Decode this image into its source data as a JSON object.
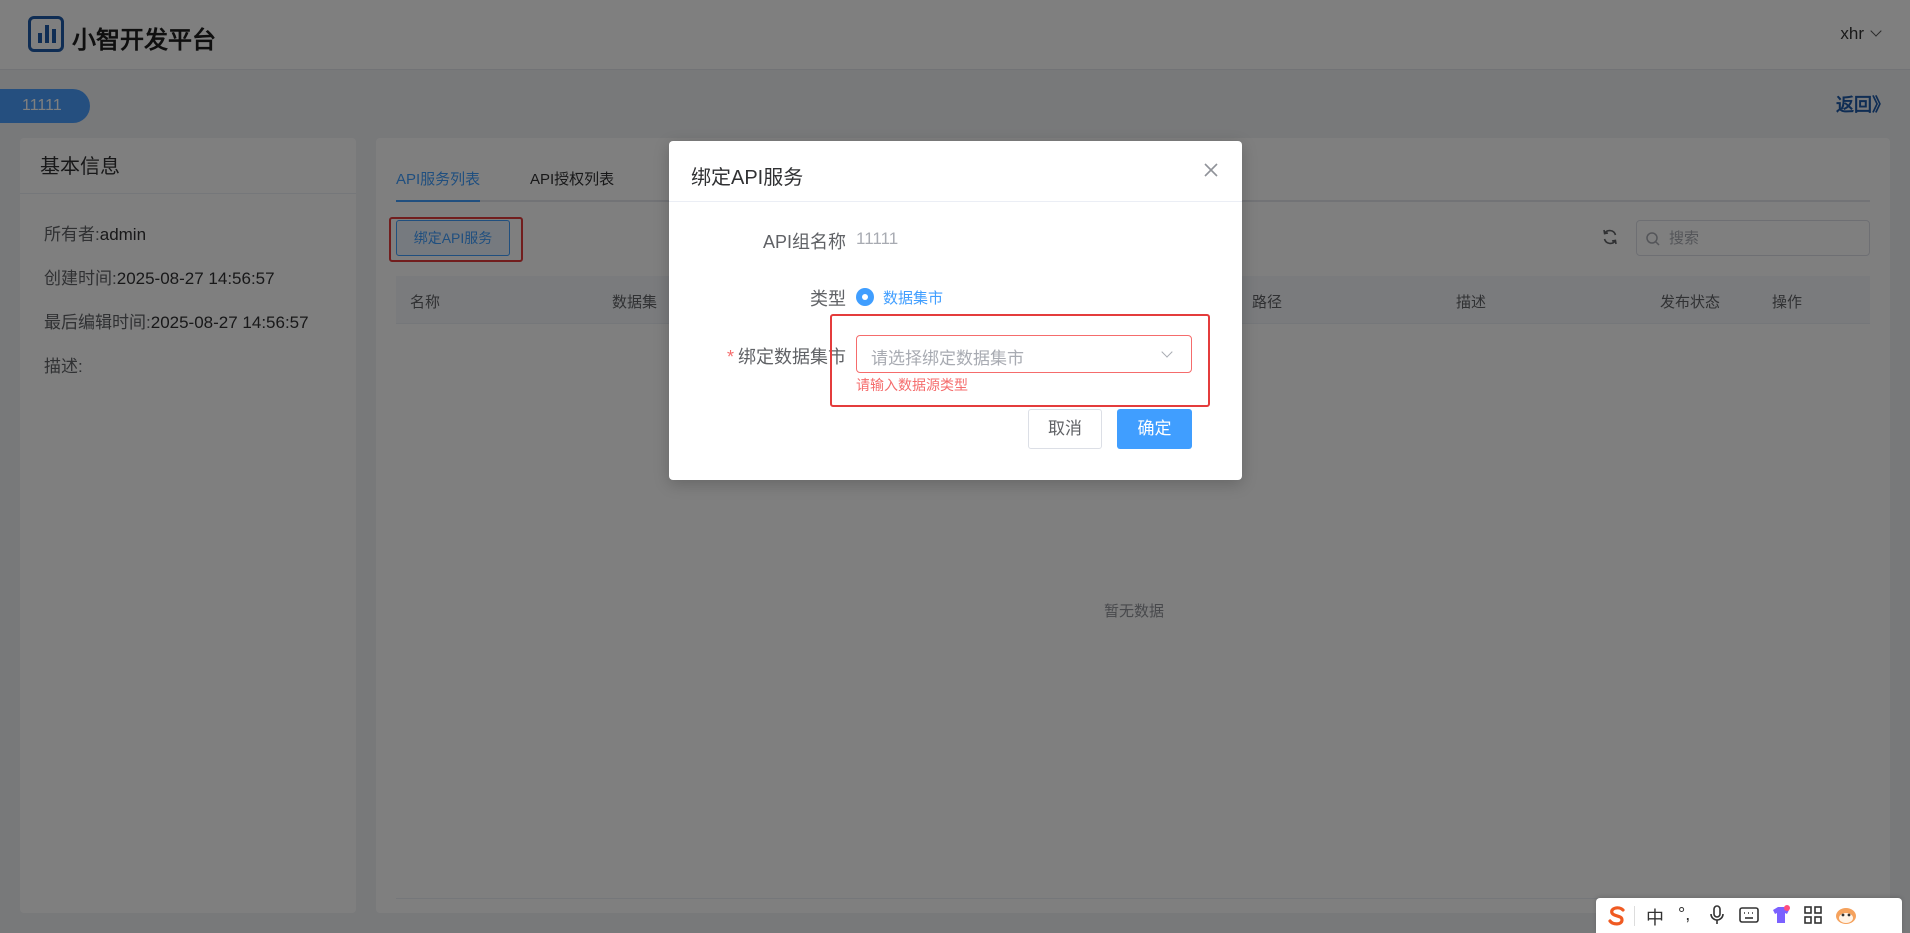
{
  "header": {
    "app_title": "小智开发平台",
    "user_name": "xhr",
    "brand_color": "#1e5aa8"
  },
  "crumb": {
    "tag": "11111",
    "back_label": "返回》"
  },
  "basic_info": {
    "title": "基本信息",
    "owner_label": "所有者:",
    "owner_value": "admin",
    "created_label": "创建时间:",
    "created_value": "2025-08-27 14:56:57",
    "edited_label": "最后编辑时间:",
    "edited_value": "2025-08-27 14:56:57",
    "desc_label": "描述:"
  },
  "tabs": [
    {
      "label": "API服务列表",
      "active": true
    },
    {
      "label": "API授权列表",
      "active": false
    }
  ],
  "toolbar": {
    "bind_button": "绑定API服务",
    "search_placeholder": "搜索"
  },
  "table": {
    "columns": [
      "名称",
      "数据集",
      "路径",
      "描述",
      "发布状态",
      "操作"
    ],
    "empty_text": "暂无数据"
  },
  "dialog": {
    "title": "绑定API服务",
    "group_label": "API组名称",
    "group_value": "11111",
    "type_label": "类型",
    "type_option": "数据集市",
    "market_required_mark": "*",
    "market_label": "绑定数据集市",
    "market_placeholder": "请选择绑定数据集市",
    "market_error": "请输入数据源类型",
    "cancel_label": "取消",
    "ok_label": "确定"
  },
  "ime": {
    "mode": "中",
    "punct": "°,"
  },
  "colors": {
    "primary": "#409eff",
    "error": "#f56c6c",
    "highlight": "#e43c3c"
  }
}
